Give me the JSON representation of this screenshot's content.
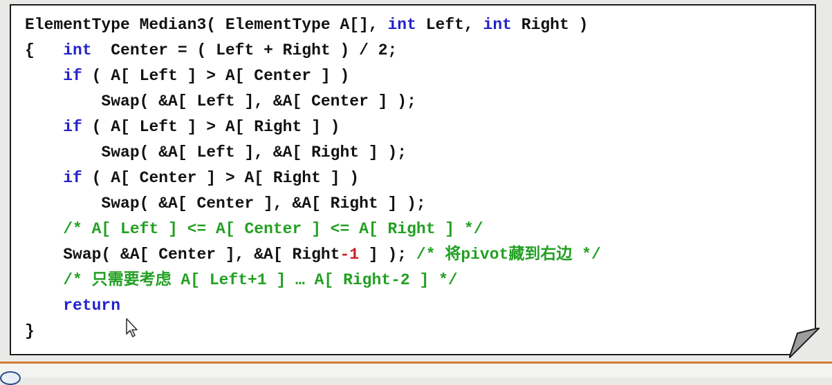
{
  "code_lines": [
    {
      "segments": [
        {
          "text": "ElementType Median3( ElementType A[], ",
          "type": "normal"
        },
        {
          "text": "int",
          "type": "keyword"
        },
        {
          "text": " Left, ",
          "type": "normal"
        },
        {
          "text": "int",
          "type": "keyword"
        },
        {
          "text": " Right )",
          "type": "normal"
        }
      ]
    },
    {
      "segments": [
        {
          "text": "{   ",
          "type": "normal"
        },
        {
          "text": "int",
          "type": "keyword"
        },
        {
          "text": "  Center = ( Left + Right ) / 2;",
          "type": "normal"
        }
      ]
    },
    {
      "segments": [
        {
          "text": "    ",
          "type": "normal"
        },
        {
          "text": "if",
          "type": "keyword"
        },
        {
          "text": " ( A[ Left ] > A[ Center ] )",
          "type": "normal"
        }
      ]
    },
    {
      "segments": [
        {
          "text": "        Swap( &A[ Left ], &A[ Center ] );",
          "type": "normal"
        }
      ]
    },
    {
      "segments": [
        {
          "text": "    ",
          "type": "normal"
        },
        {
          "text": "if",
          "type": "keyword"
        },
        {
          "text": " ( A[ Left ] > A[ Right ] )",
          "type": "normal"
        }
      ]
    },
    {
      "segments": [
        {
          "text": "        Swap( &A[ Left ], &A[ Right ] );",
          "type": "normal"
        }
      ]
    },
    {
      "segments": [
        {
          "text": "    ",
          "type": "normal"
        },
        {
          "text": "if",
          "type": "keyword"
        },
        {
          "text": " ( A[ Center ] > A[ Right ] )",
          "type": "normal"
        }
      ]
    },
    {
      "segments": [
        {
          "text": "        Swap( &A[ Center ], &A[ Right ] );",
          "type": "normal"
        }
      ]
    },
    {
      "segments": [
        {
          "text": "    ",
          "type": "normal"
        },
        {
          "text": "/* A[ Left ] <= A[ Center ] <= A[ Right ] */",
          "type": "comment"
        }
      ]
    },
    {
      "segments": [
        {
          "text": "    Swap( &A[ Center ], &A[ Right",
          "type": "normal"
        },
        {
          "text": "-1",
          "type": "highlight"
        },
        {
          "text": " ] ); ",
          "type": "normal"
        },
        {
          "text": "/* 将pivot藏到右边 */",
          "type": "comment"
        }
      ]
    },
    {
      "segments": [
        {
          "text": "    ",
          "type": "normal"
        },
        {
          "text": "/* 只需要考虑 A[ Left+1 ] … A[ Right-2 ] */",
          "type": "comment"
        }
      ]
    },
    {
      "segments": [
        {
          "text": "    ",
          "type": "normal"
        },
        {
          "text": "return",
          "type": "keyword"
        }
      ]
    },
    {
      "segments": [
        {
          "text": "}",
          "type": "normal"
        }
      ]
    }
  ],
  "colors": {
    "keyword": "#2222cc",
    "comment": "#22a022",
    "highlight": "#cc2222",
    "text": "#111111",
    "card_background": "#ffffff",
    "page_background": "#e9e9e7",
    "accent_line": "#d87a2e"
  },
  "icons": {
    "cursor": "mouse-pointer-icon",
    "fold": "page-fold-icon"
  }
}
